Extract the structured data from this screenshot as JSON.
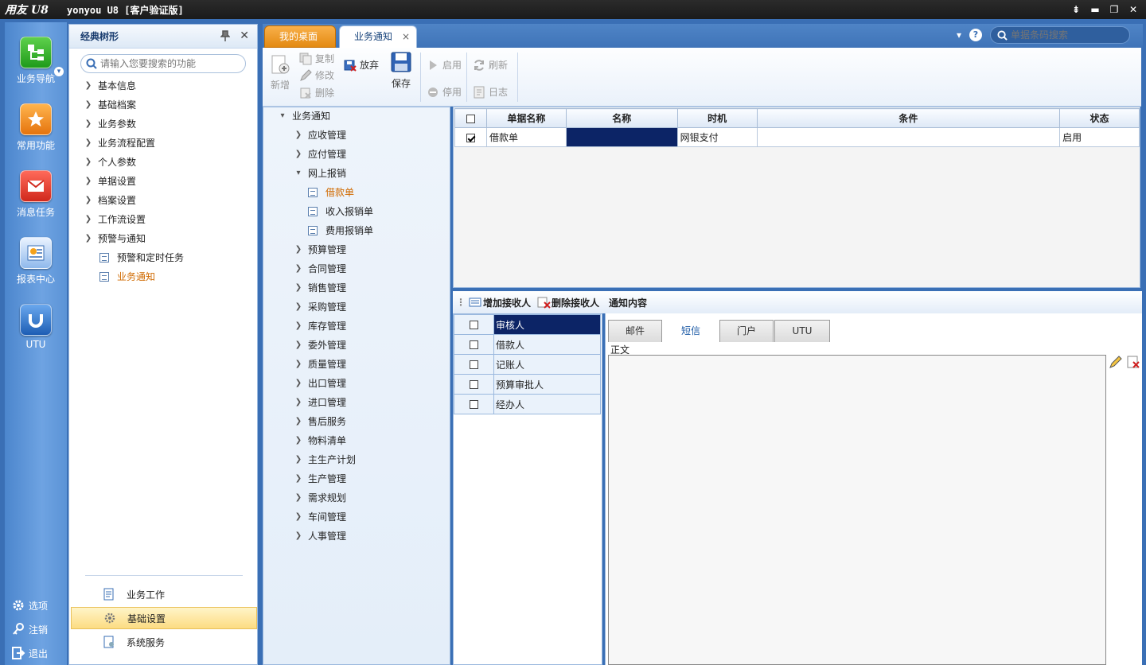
{
  "app": {
    "logo": "用友 U8",
    "title": "yonyou U8 [客户验证版]"
  },
  "window_controls": {
    "menu": "⇟",
    "minimize": "▬",
    "restore": "❐",
    "close": "✕"
  },
  "nav": [
    {
      "label": "业务导航"
    },
    {
      "label": "常用功能"
    },
    {
      "label": "消息任务"
    },
    {
      "label": "报表中心"
    },
    {
      "label": "UTU"
    }
  ],
  "bottom_links": [
    {
      "label": "选项"
    },
    {
      "label": "注销"
    },
    {
      "label": "退出"
    }
  ],
  "tree_panel": {
    "title": "经典树形",
    "pin": "▼",
    "close": "✕",
    "search_placeholder": "请输入您要搜索的功能",
    "items": [
      {
        "label": "基本信息"
      },
      {
        "label": "基础档案"
      },
      {
        "label": "业务参数"
      },
      {
        "label": "业务流程配置"
      },
      {
        "label": "个人参数"
      },
      {
        "label": "单据设置"
      },
      {
        "label": "档案设置"
      },
      {
        "label": "工作流设置"
      },
      {
        "label": "预警与通知"
      },
      {
        "label": "预警和定时任务"
      },
      {
        "label": "业务通知"
      }
    ],
    "bottom": [
      {
        "label": "业务工作"
      },
      {
        "label": "基础设置"
      },
      {
        "label": "系统服务"
      }
    ]
  },
  "tabs": {
    "desk": "我的桌面",
    "biz": "业务通知",
    "close": "×",
    "search_placeholder": "单据条码搜索",
    "help": "?",
    "dropdown": "▾"
  },
  "toolbar": {
    "new": "新增",
    "copy": "复制",
    "edit": "修改",
    "delete": "删除",
    "abandon": "放弃",
    "save": "保存",
    "enable": "启用",
    "disable": "停用",
    "refresh": "刷新",
    "log": "日志"
  },
  "mid_tree": {
    "root": "业务通知",
    "items": [
      "应收管理",
      "应付管理",
      "网上报销",
      "借款单",
      "收入报销单",
      "费用报销单",
      "预算管理",
      "合同管理",
      "销售管理",
      "采购管理",
      "库存管理",
      "委外管理",
      "质量管理",
      "出口管理",
      "进口管理",
      "售后服务",
      "物料清单",
      "主生产计划",
      "生产管理",
      "需求规划",
      "车间管理",
      "人事管理"
    ]
  },
  "grid": {
    "headers": [
      "单据名称",
      "名称",
      "时机",
      "条件",
      "状态"
    ],
    "rows": [
      {
        "doc": "借款单",
        "name": "",
        "timing": "网银支付",
        "cond": "",
        "status": "启用",
        "checked": true
      }
    ]
  },
  "receivers": {
    "add": "增加接收人",
    "delete": "删除接收人",
    "rows": [
      "审核人",
      "借款人",
      "记账人",
      "预算审批人",
      "经办人"
    ]
  },
  "notice": {
    "title": "通知内容",
    "tabs": [
      "邮件",
      "短信",
      "门户",
      "UTU"
    ],
    "body_label": "正文"
  }
}
